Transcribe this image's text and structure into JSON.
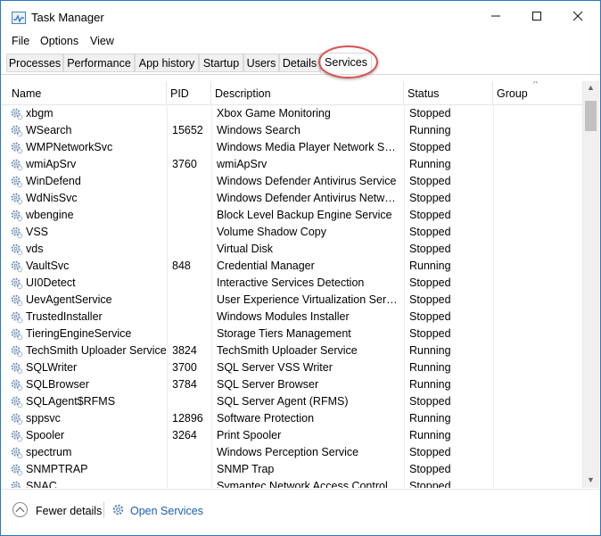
{
  "window": {
    "title": "Task Manager"
  },
  "window_controls": {
    "minimize": "—",
    "maximize": "☐",
    "close": "✕"
  },
  "menu": {
    "file": "File",
    "options": "Options",
    "view": "View"
  },
  "tabs": [
    "Processes",
    "Performance",
    "App history",
    "Startup",
    "Users",
    "Details",
    "Services"
  ],
  "active_tab": "Services",
  "highlight_color": "#d9534f",
  "columns": {
    "name": "Name",
    "pid": "PID",
    "description": "Description",
    "status": "Status",
    "group": "Group"
  },
  "services": [
    {
      "name": "xbgm",
      "pid": "",
      "description": "Xbox Game Monitoring",
      "status": "Stopped"
    },
    {
      "name": "WSearch",
      "pid": "15652",
      "description": "Windows Search",
      "status": "Running"
    },
    {
      "name": "WMPNetworkSvc",
      "pid": "",
      "description": "Windows Media Player Network Sha...",
      "status": "Stopped"
    },
    {
      "name": "wmiApSrv",
      "pid": "3760",
      "description": "wmiApSrv",
      "status": "Running"
    },
    {
      "name": "WinDefend",
      "pid": "",
      "description": "Windows Defender Antivirus Service",
      "status": "Stopped"
    },
    {
      "name": "WdNisSvc",
      "pid": "",
      "description": "Windows Defender Antivirus Networ...",
      "status": "Stopped"
    },
    {
      "name": "wbengine",
      "pid": "",
      "description": "Block Level Backup Engine Service",
      "status": "Stopped"
    },
    {
      "name": "VSS",
      "pid": "",
      "description": "Volume Shadow Copy",
      "status": "Stopped"
    },
    {
      "name": "vds",
      "pid": "",
      "description": "Virtual Disk",
      "status": "Stopped"
    },
    {
      "name": "VaultSvc",
      "pid": "848",
      "description": "Credential Manager",
      "status": "Running"
    },
    {
      "name": "UI0Detect",
      "pid": "",
      "description": "Interactive Services Detection",
      "status": "Stopped"
    },
    {
      "name": "UevAgentService",
      "pid": "",
      "description": "User Experience Virtualization Service",
      "status": "Stopped"
    },
    {
      "name": "TrustedInstaller",
      "pid": "",
      "description": "Windows Modules Installer",
      "status": "Stopped"
    },
    {
      "name": "TieringEngineService",
      "pid": "",
      "description": "Storage Tiers Management",
      "status": "Stopped"
    },
    {
      "name": "TechSmith Uploader Service",
      "pid": "3824",
      "description": "TechSmith Uploader Service",
      "status": "Running"
    },
    {
      "name": "SQLWriter",
      "pid": "3700",
      "description": "SQL Server VSS Writer",
      "status": "Running"
    },
    {
      "name": "SQLBrowser",
      "pid": "3784",
      "description": "SQL Server Browser",
      "status": "Running"
    },
    {
      "name": "SQLAgent$RFMS",
      "pid": "",
      "description": "SQL Server Agent (RFMS)",
      "status": "Stopped"
    },
    {
      "name": "sppsvc",
      "pid": "12896",
      "description": "Software Protection",
      "status": "Running"
    },
    {
      "name": "Spooler",
      "pid": "3264",
      "description": "Print Spooler",
      "status": "Running"
    },
    {
      "name": "spectrum",
      "pid": "",
      "description": "Windows Perception Service",
      "status": "Stopped"
    },
    {
      "name": "SNMPTRAP",
      "pid": "",
      "description": "SNMP Trap",
      "status": "Stopped"
    },
    {
      "name": "SNAC",
      "pid": "",
      "description": "Symantec Network Access Control",
      "status": "Stopped"
    }
  ],
  "footer": {
    "fewer_details": "Fewer details",
    "open_services": "Open Services"
  },
  "colors": {
    "link": "#1a5fb4",
    "window_border": "#2b78c5"
  }
}
